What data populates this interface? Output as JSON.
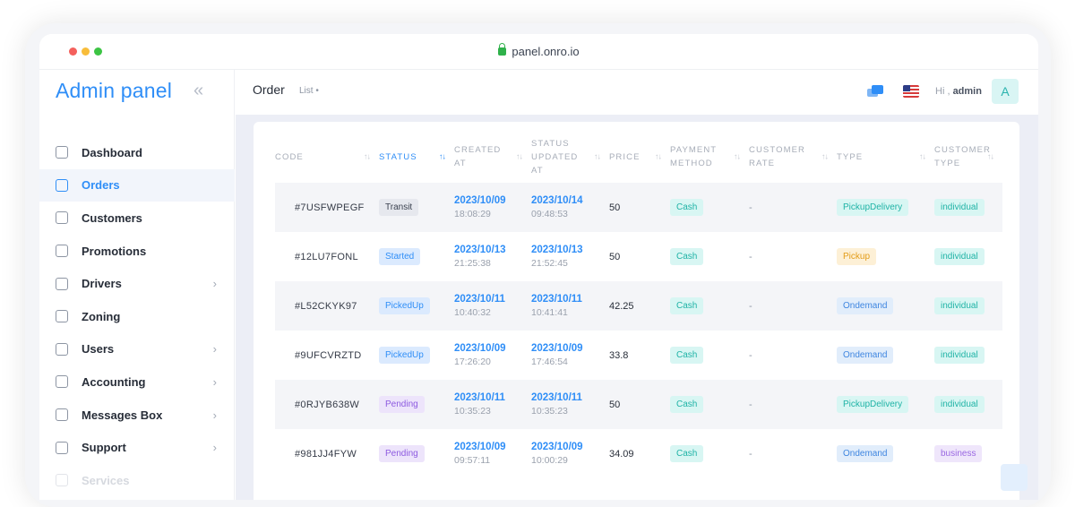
{
  "browser": {
    "url": "panel.onro.io"
  },
  "sidebar": {
    "brand": "Admin panel",
    "items": [
      {
        "label": "Dashboard",
        "icon": "home-icon"
      },
      {
        "label": "Orders",
        "icon": "orders-icon",
        "active": true
      },
      {
        "label": "Customers",
        "icon": "customers-icon"
      },
      {
        "label": "Promotions",
        "icon": "promotions-icon"
      },
      {
        "label": "Drivers",
        "icon": "drivers-icon",
        "chevron": true
      },
      {
        "label": "Zoning",
        "icon": "zoning-icon"
      },
      {
        "label": "Users",
        "icon": "users-icon",
        "chevron": true
      },
      {
        "label": "Accounting",
        "icon": "accounting-icon",
        "chevron": true
      },
      {
        "label": "Messages Box",
        "icon": "messages-icon",
        "chevron": true
      },
      {
        "label": "Support",
        "icon": "support-icon",
        "chevron": true
      },
      {
        "label": "Services",
        "icon": "services-icon"
      }
    ]
  },
  "header": {
    "title": "Order",
    "view": "List",
    "greeting_prefix": "Hi ,",
    "user": "admin",
    "avatar_letter": "A"
  },
  "table": {
    "columns": [
      {
        "line1": "CODE",
        "line2": "",
        "line3": ""
      },
      {
        "line1": "STATUS",
        "line2": "",
        "line3": "",
        "sorted": true
      },
      {
        "line1": "CREATED",
        "line2": "AT",
        "line3": ""
      },
      {
        "line1": "STATUS",
        "line2": "UPDATED",
        "line3": "AT"
      },
      {
        "line1": "PRICE",
        "line2": "",
        "line3": ""
      },
      {
        "line1": "PAYMENT",
        "line2": "METHOD",
        "line3": ""
      },
      {
        "line1": "CUSTOMER",
        "line2": "RATE",
        "line3": ""
      },
      {
        "line1": "TYPE",
        "line2": "",
        "line3": ""
      },
      {
        "line1": "CUSTOMER",
        "line2": "TYPE",
        "line3": ""
      }
    ],
    "rows": [
      {
        "code": "#7USFWPEGF",
        "status": "Transit",
        "created_date": "2023/10/09",
        "created_time": "18:08:29",
        "updated_date": "2023/10/14",
        "updated_time": "09:48:53",
        "price": "50",
        "payment": "Cash",
        "rate": "-",
        "type": "PickupDelivery",
        "customer_type": "individual"
      },
      {
        "code": "#12LU7FONL",
        "status": "Started",
        "created_date": "2023/10/13",
        "created_time": "21:25:38",
        "updated_date": "2023/10/13",
        "updated_time": "21:52:45",
        "price": "50",
        "payment": "Cash",
        "rate": "-",
        "type": "Pickup",
        "customer_type": "individual"
      },
      {
        "code": "#L52CKYK97",
        "status": "PickedUp",
        "created_date": "2023/10/11",
        "created_time": "10:40:32",
        "updated_date": "2023/10/11",
        "updated_time": "10:41:41",
        "price": "42.25",
        "payment": "Cash",
        "rate": "-",
        "type": "Ondemand",
        "customer_type": "individual"
      },
      {
        "code": "#9UFCVRZTD",
        "status": "PickedUp",
        "created_date": "2023/10/09",
        "created_time": "17:26:20",
        "updated_date": "2023/10/09",
        "updated_time": "17:46:54",
        "price": "33.8",
        "payment": "Cash",
        "rate": "-",
        "type": "Ondemand",
        "customer_type": "individual"
      },
      {
        "code": "#0RJYB638W",
        "status": "Pending",
        "created_date": "2023/10/11",
        "created_time": "10:35:23",
        "updated_date": "2023/10/11",
        "updated_time": "10:35:23",
        "price": "50",
        "payment": "Cash",
        "rate": "-",
        "type": "PickupDelivery",
        "customer_type": "individual"
      },
      {
        "code": "#981JJ4FYW",
        "status": "Pending",
        "created_date": "2023/10/09",
        "created_time": "09:57:11",
        "updated_date": "2023/10/09",
        "updated_time": "10:00:29",
        "price": "34.09",
        "payment": "Cash",
        "rate": "-",
        "type": "Ondemand",
        "customer_type": "business"
      }
    ]
  },
  "colors": {
    "accent": "#2f8ef7",
    "status": {
      "Transit": {
        "bg": "#e6e8ee",
        "fg": "#3b4250"
      },
      "Started": {
        "bg": "#dbeafe",
        "fg": "#2f8ef7"
      },
      "PickedUp": {
        "bg": "#dbeafe",
        "fg": "#2f8ef7"
      },
      "Pending": {
        "bg": "#ede4fb",
        "fg": "#8d5ae0"
      }
    },
    "type": {
      "PickupDelivery": {
        "bg": "#d8f6f3",
        "fg": "#1fb3a6"
      },
      "Pickup": {
        "bg": "#fdf0d6",
        "fg": "#e39c18"
      },
      "Ondemand": {
        "bg": "#e1edfb",
        "fg": "#3f86e0"
      }
    },
    "customer_type": {
      "individual": {
        "bg": "#d8f6f3",
        "fg": "#1fb3a6"
      },
      "business": {
        "bg": "#efe6fb",
        "fg": "#9a68e2"
      }
    },
    "payment": {
      "bg": "#d8f6f3",
      "fg": "#1fb3a6"
    }
  }
}
